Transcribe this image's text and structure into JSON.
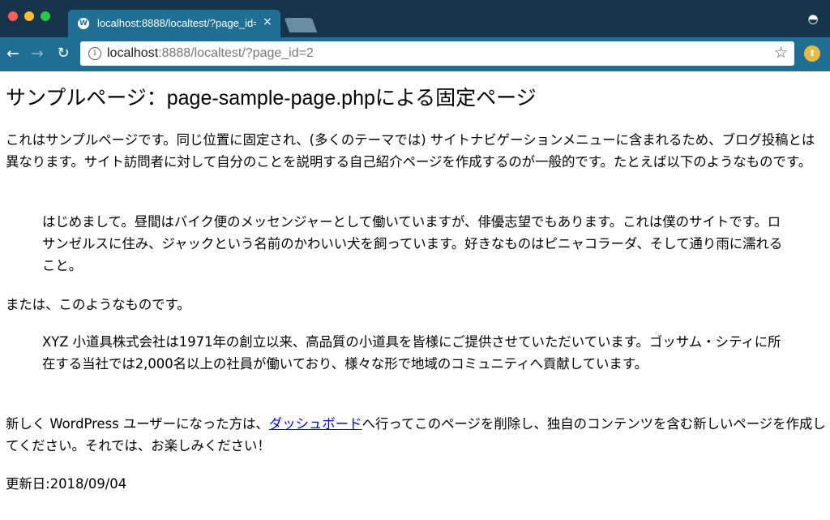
{
  "browser": {
    "tab": {
      "title": "localhost:8888/localtest/?page_id=2",
      "close": "×"
    },
    "toolbar": {
      "url_host": "localhost",
      "url_rest": ":8888/localtest/?page_id=2"
    },
    "icons": [
      "favicon-icon",
      "close-icon",
      "incognito-icon",
      "back-icon",
      "forward-icon",
      "reload-icon",
      "info-icon",
      "star-icon",
      "extension-icon"
    ],
    "colors": {
      "titlebar": "#17354a",
      "toolbar": "#1e6f93",
      "link": "#0000ee"
    }
  },
  "page": {
    "title": "サンプルページ：page-sample-page.phpによる固定ページ",
    "intro": "これはサンプルページです。同じ位置に固定され、(多くのテーマでは) サイトナビゲーションメニューに含まれるため、ブログ投稿とは異なります。サイト訪問者に対して自分のことを説明する自己紹介ページを作成するのが一般的です。たとえば以下のようなものです。",
    "quote1": "はじめまして。昼間はバイク便のメッセンジャーとして働いていますが、俳優志望でもあります。これは僕のサイトです。ロサンゼルスに住み、ジャックという名前のかわいい犬を飼っています。好きなものはピニャコラーダ、そして通り雨に濡れること。",
    "or_text": "または、このようなものです。",
    "quote2": "XYZ 小道具株式会社は1971年の創立以来、高品質の小道具を皆様にご提供させていただいています。ゴッサム・シティに所在する当社では2,000名以上の社員が働いており、様々な形で地域のコミュニティへ貢献しています。",
    "para_before_link": "新しく WordPress ユーザーになった方は、",
    "link_text": "ダッシュボード",
    "para_after_link": "へ行ってこのページを削除し、独自のコンテンツを含む新しいページを作成してください。それでは、お楽しみください！",
    "updated": "更新日:2018/09/04"
  }
}
